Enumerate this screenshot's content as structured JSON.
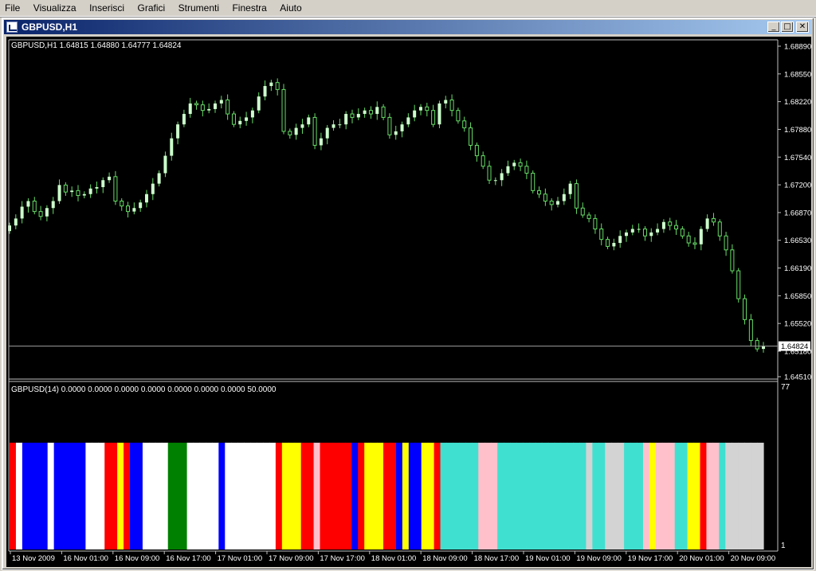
{
  "menu": [
    "File",
    "Visualizza",
    "Inserisci",
    "Grafici",
    "Strumenti",
    "Finestra",
    "Aiuto"
  ],
  "window": {
    "title": "GBPUSD,H1",
    "min_glyph": "_",
    "max_glyph": "□",
    "close_glyph": "✕"
  },
  "chart": {
    "header": "GBPUSD,H1  1.64815 1.64880 1.64777 1.64824",
    "current_price": "1.64824",
    "price_ticks": [
      "1.68890",
      "1.68550",
      "1.68220",
      "1.67880",
      "1.67540",
      "1.67200",
      "1.66870",
      "1.66530",
      "1.66190",
      "1.65850",
      "1.65520",
      "1.65180",
      "1.64510"
    ]
  },
  "indicator": {
    "header": "GBPUSD(14) 0.0000 0.0000 0.0000 0.0000 0.0000 0.0000 0.0000 50.0000",
    "scale_top": "77",
    "scale_bottom": "1"
  },
  "time_labels": [
    "13 Nov 2009",
    "16 Nov 01:00",
    "16 Nov 09:00",
    "16 Nov 17:00",
    "17 Nov 01:00",
    "17 Nov 09:00",
    "17 Nov 17:00",
    "18 Nov 01:00",
    "18 Nov 09:00",
    "18 Nov 17:00",
    "19 Nov 01:00",
    "19 Nov 09:00",
    "19 Nov 17:00",
    "20 Nov 01:00",
    "20 Nov 09:00"
  ],
  "colors": {
    "red": "#ff0000",
    "blue": "#0000ff",
    "white": "#ffffff",
    "yellow": "#ffff00",
    "green": "#008000",
    "pink": "#ffc0cb",
    "turquoise": "#40e0d0",
    "gray": "#d3d3d3",
    "bull": "#ccffcc",
    "wick": "#66dd66"
  },
  "chart_data": [
    {
      "type": "candlestick",
      "title": "GBPUSD,H1  1.64815 1.64880 1.64777 1.64824",
      "ylim": [
        1.6437,
        1.6919
      ],
      "closes": [
        1.6655,
        1.6665,
        1.6682,
        1.669,
        1.6675,
        1.6668,
        1.668,
        1.669,
        1.6713,
        1.6703,
        1.6705,
        1.6698,
        1.67,
        1.6708,
        1.671,
        1.672,
        1.6725,
        1.669,
        1.6683,
        1.6675,
        1.668,
        1.6688,
        1.67,
        1.6715,
        1.673,
        1.6755,
        1.678,
        1.68,
        1.6815,
        1.683,
        1.6828,
        1.682,
        1.6822,
        1.683,
        1.6835,
        1.6815,
        1.68,
        1.6805,
        1.681,
        1.682,
        1.684,
        1.6855,
        1.686,
        1.685,
        1.679,
        1.6785,
        1.6795,
        1.68,
        1.681,
        1.677,
        1.678,
        1.6795,
        1.68,
        1.68,
        1.6815,
        1.681,
        1.6815,
        1.682,
        1.6815,
        1.6825,
        1.681,
        1.6785,
        1.679,
        1.68,
        1.681,
        1.682,
        1.6825,
        1.682,
        1.68,
        1.683,
        1.6835,
        1.682,
        1.6805,
        1.6795,
        1.677,
        1.6755,
        1.674,
        1.672,
        1.672,
        1.673,
        1.674,
        1.6745,
        1.674,
        1.673,
        1.6705,
        1.67,
        1.669,
        1.6685,
        1.669,
        1.67,
        1.6715,
        1.668,
        1.667,
        1.6665,
        1.665,
        1.6635,
        1.6625,
        1.663,
        1.664,
        1.6645,
        1.665,
        1.665,
        1.664,
        1.6645,
        1.665,
        1.666,
        1.6655,
        1.665,
        1.664,
        1.663,
        1.6628,
        1.665,
        1.6665,
        1.666,
        1.664,
        1.662,
        1.659,
        1.655,
        1.652,
        1.649,
        1.6478,
        1.6482
      ]
    },
    {
      "type": "categorical-bands",
      "title": "GBPUSD(14) 0.0000 0.0000 0.0000 0.0000 0.0000 0.0000 0.0000 50.0000",
      "ylim": [
        1,
        77
      ],
      "bands": [
        "red",
        "white",
        "blue",
        "blue",
        "blue",
        "blue",
        "white",
        "blue",
        "blue",
        "blue",
        "blue",
        "blue",
        "white",
        "white",
        "white",
        "red",
        "red",
        "yellow",
        "red",
        "blue",
        "blue",
        "white",
        "white",
        "white",
        "white",
        "green",
        "green",
        "green",
        "white",
        "white",
        "white",
        "white",
        "white",
        "blue",
        "white",
        "white",
        "white",
        "white",
        "white",
        "white",
        "white",
        "white",
        "red",
        "yellow",
        "yellow",
        "yellow",
        "red",
        "red",
        "pink",
        "red",
        "red",
        "red",
        "red",
        "red",
        "blue",
        "red",
        "yellow",
        "yellow",
        "yellow",
        "red",
        "red",
        "blue",
        "yellow",
        "blue",
        "blue",
        "yellow",
        "yellow",
        "red",
        "turquoise",
        "turquoise",
        "turquoise",
        "turquoise",
        "turquoise",
        "turquoise",
        "pink",
        "pink",
        "pink",
        "turquoise",
        "turquoise",
        "turquoise",
        "turquoise",
        "turquoise",
        "turquoise",
        "turquoise",
        "turquoise",
        "turquoise",
        "turquoise",
        "turquoise",
        "turquoise",
        "turquoise",
        "turquoise",
        "gray",
        "turquoise",
        "turquoise",
        "gray",
        "gray",
        "gray",
        "turquoise",
        "turquoise",
        "turquoise",
        "pink",
        "yellow",
        "pink",
        "pink",
        "pink",
        "turquoise",
        "turquoise",
        "yellow",
        "yellow",
        "red",
        "pink",
        "pink",
        "turquoise",
        "gray",
        "gray",
        "gray",
        "gray",
        "gray",
        "gray"
      ]
    }
  ]
}
